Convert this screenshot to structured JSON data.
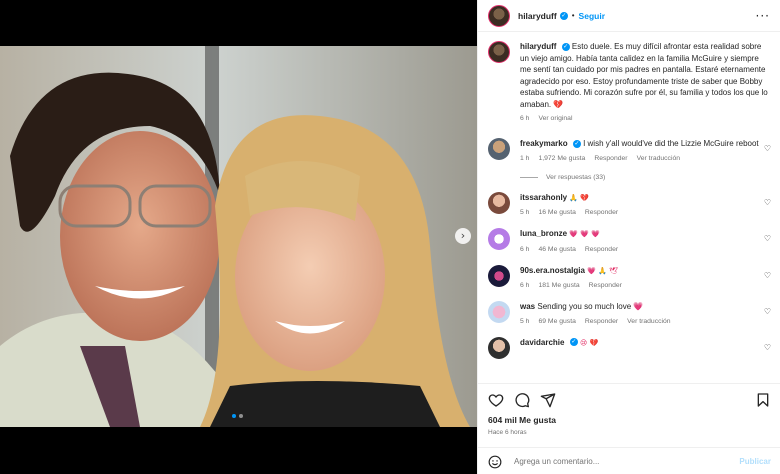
{
  "media": {
    "next_glyph": "›",
    "dots": 2,
    "active_dot": 0
  },
  "header": {
    "username": "hilaryduff",
    "separator": "•",
    "follow_label": "Seguir",
    "more_glyph": "···"
  },
  "caption": {
    "username": "hilaryduff",
    "text": "Esto duele. Es muy difícil afrontar esta realidad sobre un viejo amigo. Había tanta calidez en la familia McGuire y siempre me sentí tan cuidado por mis padres en pantalla. Estaré eternamente agradecido por eso. Estoy profundamente triste de saber que Bobby estaba sufriendo. Mi corazón sufre por él, su familia y todos los que lo amaban. 💔",
    "time": "6 h",
    "see_original": "Ver original"
  },
  "comments": [
    {
      "username": "freakymarko",
      "verified": true,
      "text": "I wish y'all would've did the Lizzie McGuire reboot",
      "time": "1 h",
      "likes": "1,972 Me gusta",
      "reply": "Responder",
      "translate": "Ver traducción"
    },
    {
      "username": "itssarahonly",
      "verified": false,
      "text": "🙏 💔",
      "time": "5 h",
      "likes": "16 Me gusta",
      "reply": "Responder",
      "translate": ""
    },
    {
      "username": "luna_bronze",
      "verified": false,
      "text": "💗 💗 💗",
      "time": "6 h",
      "likes": "46 Me gusta",
      "reply": "Responder",
      "translate": ""
    },
    {
      "username": "90s.era.nostalgia",
      "verified": false,
      "text": "💗 🙏 🕊",
      "time": "6 h",
      "likes": "181 Me gusta",
      "reply": "Responder",
      "translate": ""
    },
    {
      "username": "was",
      "verified": false,
      "text": "Sending you so much love 💗",
      "time": "5 h",
      "likes": "69 Me gusta",
      "reply": "Responder",
      "translate": "Ver traducción"
    },
    {
      "username": "davidarchie",
      "verified": true,
      "text": "😢 💔",
      "time": "",
      "likes": "",
      "reply": "",
      "translate": ""
    }
  ],
  "view_replies": "Ver respuestas (33)",
  "actions": {
    "likes": "604 mil Me gusta",
    "ago": "Hace 6 horas"
  },
  "add_comment": {
    "placeholder": "Agrega un comentario...",
    "publish": "Publicar"
  },
  "colors": {
    "accent": "#0095f6",
    "heart": "#e0245e"
  }
}
